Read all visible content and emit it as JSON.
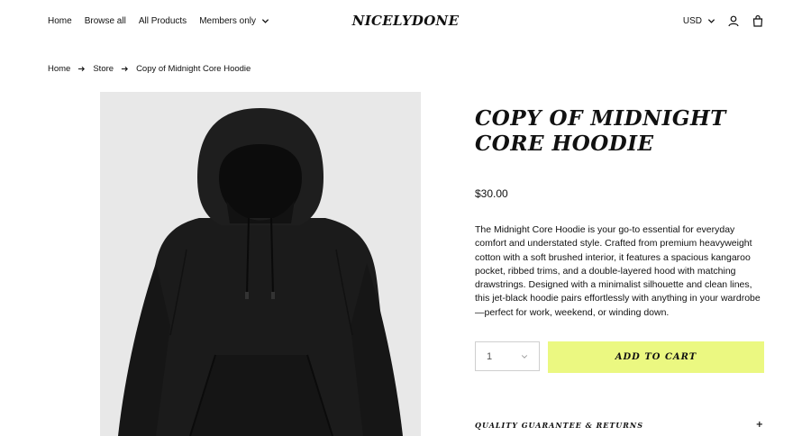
{
  "header": {
    "nav": [
      "Home",
      "Browse all",
      "All Products"
    ],
    "members_label": "Members only",
    "logo": "NICELYDONE",
    "currency": "USD"
  },
  "breadcrumb": [
    "Home",
    "Store",
    "Copy of Midnight Core Hoodie"
  ],
  "product": {
    "title": "Copy of Midnight Core Hoodie",
    "price": "$30.00",
    "description": "The Midnight Core Hoodie is your go-to essential for everyday comfort and understated style. Crafted from premium heavyweight cotton with a soft brushed interior, it features a spacious kangaroo pocket, ribbed trims, and a double-layered hood with matching drawstrings. Designed with a minimalist silhouette and clean lines, this jet-black hoodie pairs effortlessly with anything in your wardrobe—perfect for work, weekend, or winding down.",
    "quantity": "1",
    "add_to_cart": "Add to cart",
    "accordion_label": "Quality guarantee & returns",
    "accordion_toggle": "+"
  },
  "colors": {
    "accent": "#ebf881",
    "image_bg": "#e8e8e8",
    "text": "#111111"
  },
  "icons": [
    "chevron-down-icon",
    "user-icon",
    "bag-icon",
    "arrow-right-icon",
    "hoodie-image"
  ]
}
